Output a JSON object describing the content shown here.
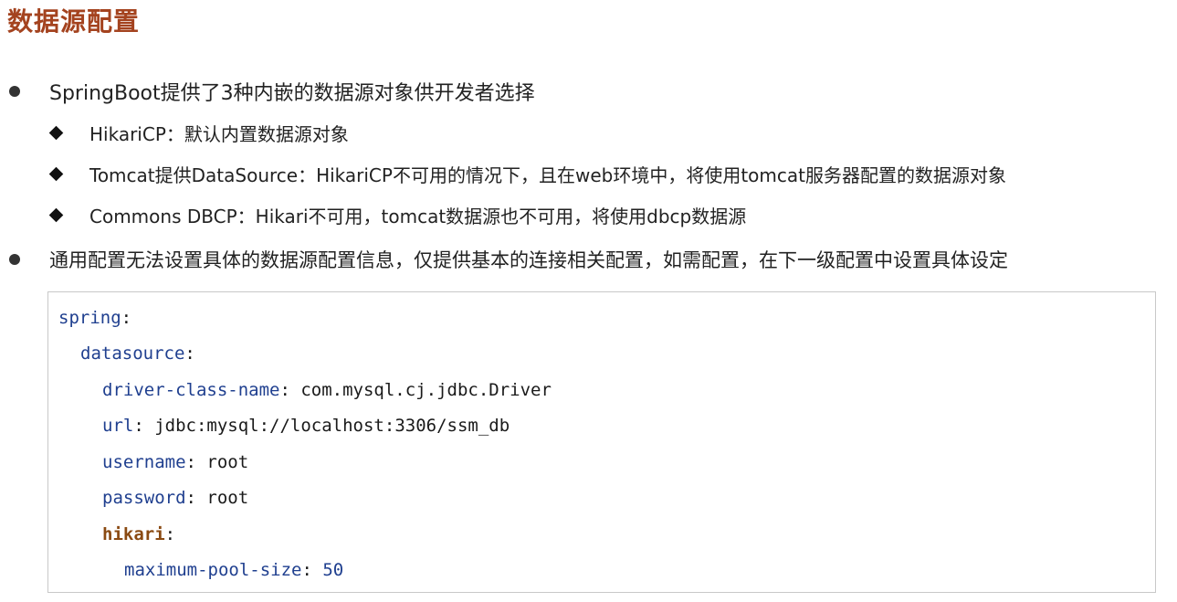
{
  "title": "数据源配置",
  "bullets": [
    {
      "text": "SpringBoot提供了3种内嵌的数据源对象供开发者选择",
      "sub_items": [
        "HikariCP：默认内置数据源对象",
        "Tomcat提供DataSource：HikariCP不可用的情况下，且在web环境中，将使用tomcat服务器配置的数据源对象",
        "Commons DBCP：Hikari不可用，tomcat数据源也不可用，将使用dbcp数据源"
      ]
    },
    {
      "text": "通用配置无法设置具体的数据源配置信息，仅提供基本的连接相关配置，如需配置，在下一级配置中设置具体设定"
    }
  ],
  "code": {
    "lines": [
      {
        "key": "spring",
        "sep": ":",
        "value": ""
      },
      {
        "key": "datasource",
        "sep": ":",
        "value": ""
      },
      {
        "key": "driver-class-name",
        "sep": ": ",
        "value": "com.mysql.cj.jdbc.Driver"
      },
      {
        "key": "url",
        "sep": ": ",
        "value": "jdbc:mysql://localhost:3306/ssm_db"
      },
      {
        "key": "username",
        "sep": ": ",
        "value": "root"
      },
      {
        "key": "password",
        "sep": ": ",
        "value": "root"
      },
      {
        "key": "hikari",
        "sep": ":",
        "value": ""
      },
      {
        "key": "maximum-pool-size",
        "sep": ": ",
        "value": "50"
      }
    ]
  },
  "colors": {
    "title": "#a4431f",
    "code_key": "#1f3f8f",
    "code_key_bold": "#8a4a12",
    "code_number": "#1f3f8f"
  }
}
